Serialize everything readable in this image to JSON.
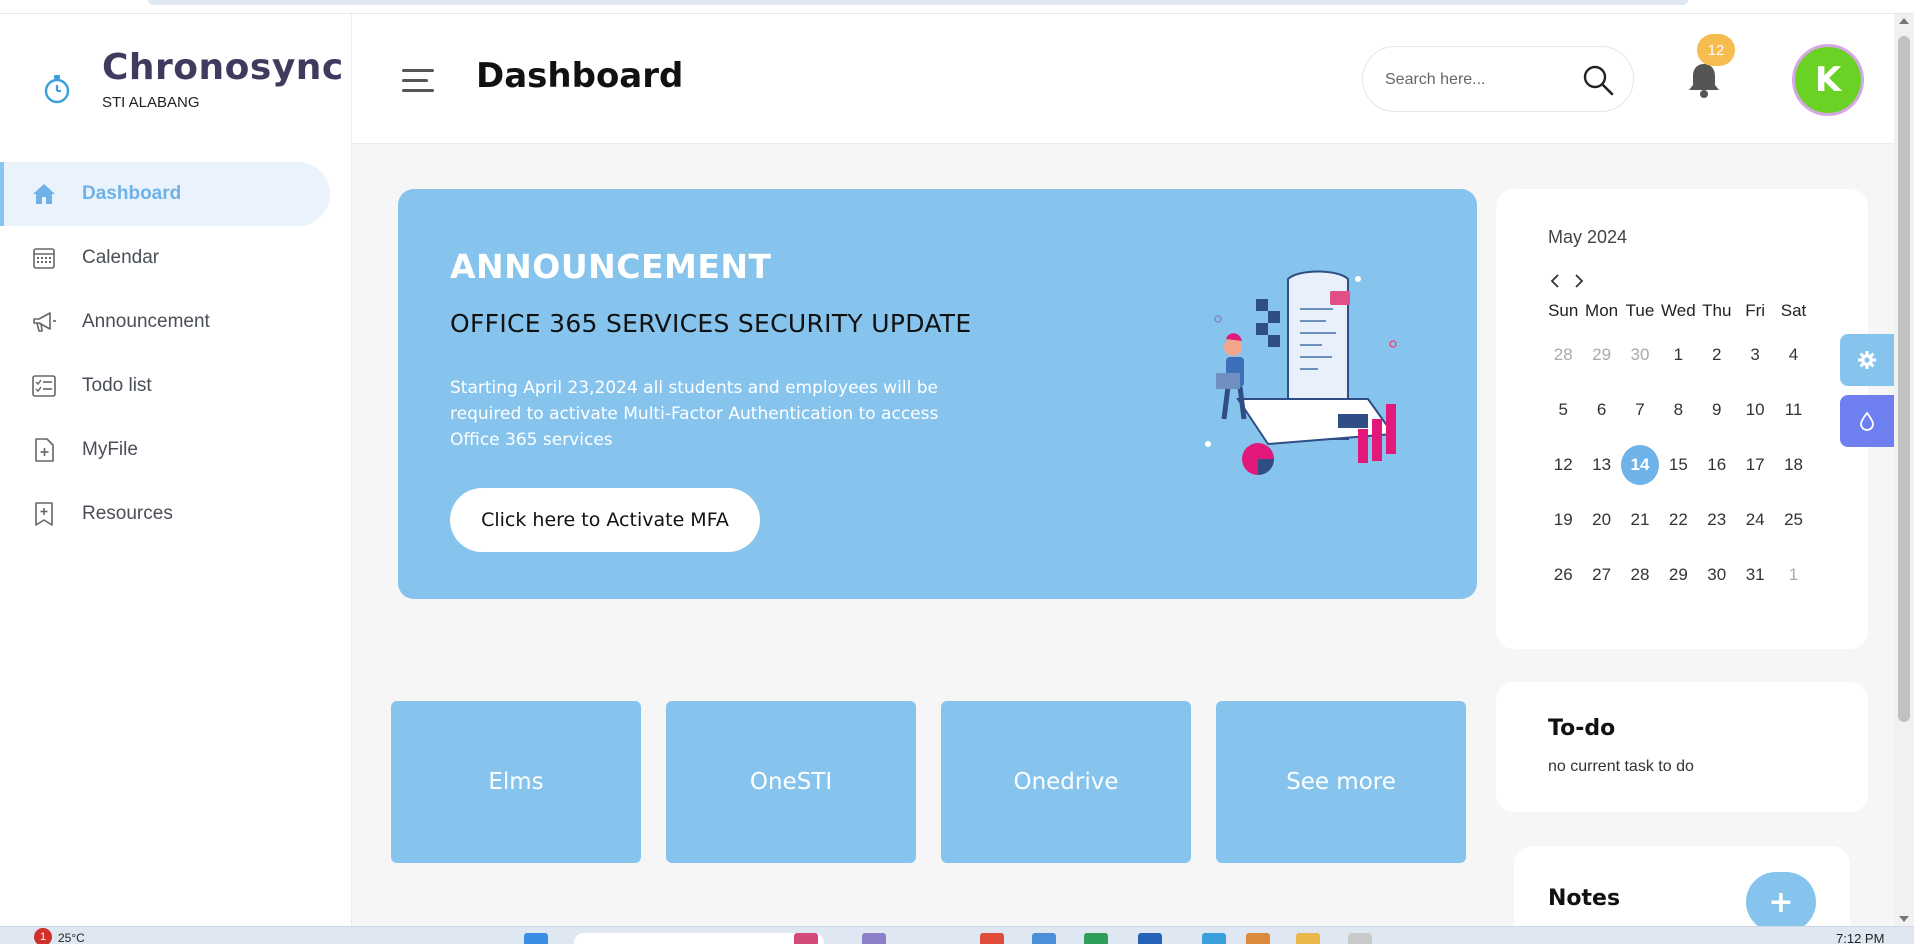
{
  "brand": {
    "title": "Chronosync",
    "subtitle": "STI ALABANG",
    "icon": "stopwatch-icon"
  },
  "sidebar": {
    "items": [
      {
        "label": "Dashboard",
        "icon": "home-icon",
        "active": true
      },
      {
        "label": "Calendar",
        "icon": "calendar-icon",
        "active": false
      },
      {
        "label": "Announcement",
        "icon": "megaphone-icon",
        "active": false
      },
      {
        "label": "Todo list",
        "icon": "checklist-icon",
        "active": false
      },
      {
        "label": "MyFile",
        "icon": "file-add-icon",
        "active": false
      },
      {
        "label": "Resources",
        "icon": "bookmark-add-icon",
        "active": false
      }
    ]
  },
  "header": {
    "title": "Dashboard",
    "search_placeholder": "Search here...",
    "notification_count": "12",
    "avatar_initial": "K"
  },
  "announcement": {
    "heading": "ANNOUNCEMENT",
    "subject": "OFFICE 365 SERVICES SECURITY UPDATE",
    "body": "Starting April 23,2024 all students and employees will be required to activate Multi-Factor Authentication to access Office 365 services",
    "button_label": "Click here to Activate MFA"
  },
  "tiles": [
    {
      "label": "Elms"
    },
    {
      "label": "OneSTI"
    },
    {
      "label": "Onedrive"
    },
    {
      "label": "See more"
    }
  ],
  "calendar": {
    "month_label": "May 2024",
    "weekdays": [
      "Sun",
      "Mon",
      "Tue",
      "Wed",
      "Thu",
      "Fri",
      "Sat"
    ],
    "weeks": [
      [
        "28",
        "29",
        "30",
        "1",
        "2",
        "3",
        "4"
      ],
      [
        "5",
        "6",
        "7",
        "8",
        "9",
        "10",
        "11"
      ],
      [
        "12",
        "13",
        "14",
        "15",
        "16",
        "17",
        "18"
      ],
      [
        "19",
        "20",
        "21",
        "22",
        "23",
        "24",
        "25"
      ],
      [
        "26",
        "27",
        "28",
        "29",
        "30",
        "31",
        "1"
      ]
    ],
    "muted": [
      [
        0,
        0
      ],
      [
        0,
        1
      ],
      [
        0,
        2
      ],
      [
        4,
        6
      ]
    ],
    "today": [
      2,
      2
    ]
  },
  "todo": {
    "title": "To-do",
    "empty_text": "no current task to do"
  },
  "notes": {
    "title": "Notes",
    "add_label": "+"
  },
  "taskbar": {
    "weather": "25°C",
    "badge": "1",
    "time": "7:12 PM"
  },
  "colors": {
    "accent": "#86c4ee",
    "active_nav": "#6fb2e8",
    "badge": "#f6bc4f",
    "avatar": "#6ad125",
    "theme_button": "#6e7ff0"
  }
}
